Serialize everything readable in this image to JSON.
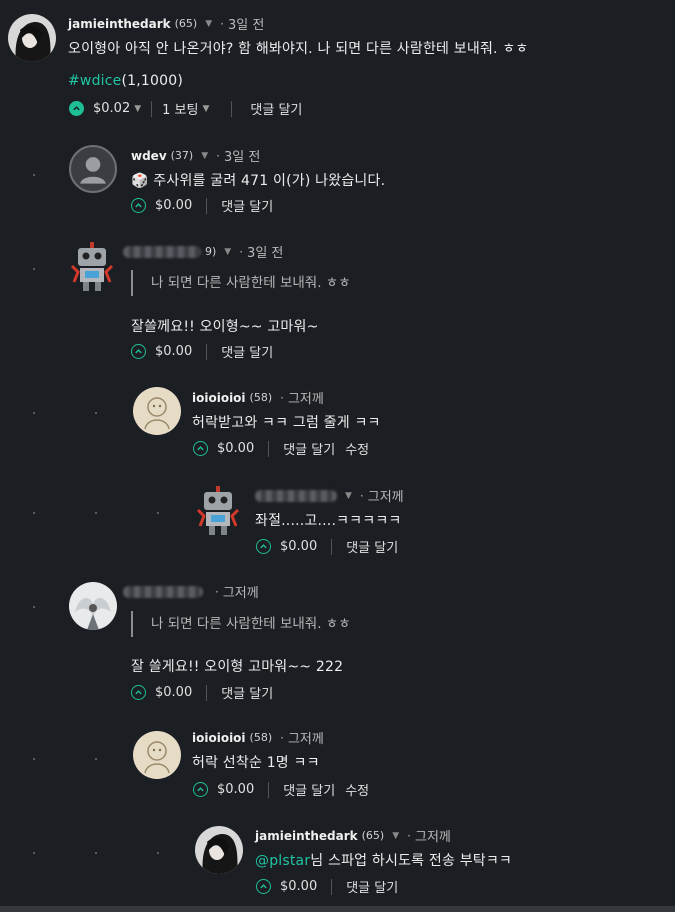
{
  "comments": [
    {
      "author": "jamieinthedark",
      "rep": "(65)",
      "time": "3일 전",
      "body": "오이형아 아직 안 나온거야? 함 해봐야지. 나 되면 다른 사람한테 보내줘. ㅎㅎ",
      "tag": "#wdice",
      "tag_args": "(1,1000)",
      "payout": "$0.02",
      "votes": "1 보팅",
      "reply": "댓글 달기"
    },
    {
      "author": "wdev",
      "rep": "(37)",
      "time": "3일 전",
      "body": "🎲 주사위를 굴려 471 이(가) 나왔습니다.",
      "payout": "$0.00",
      "reply": "댓글 달기"
    },
    {
      "rep": "9)",
      "time": "3일 전",
      "quote": "나 되면 다른 사람한테 보내줘. ㅎㅎ",
      "body": "잘쓸께요!! 오이형~~ 고마워~",
      "payout": "$0.00",
      "reply": "댓글 달기"
    },
    {
      "author": "ioioioioi",
      "rep": "(58)",
      "time": "그저께",
      "body": "허락받고와 ㅋㅋ 그럼 줄게 ㅋㅋ",
      "payout": "$0.00",
      "reply": "댓글 달기",
      "edit": "수정"
    },
    {
      "time": "그저께",
      "body": "좌절.....고....ㅋㅋㅋㅋㅋ",
      "payout": "$0.00",
      "reply": "댓글 달기"
    },
    {
      "time": "그저께",
      "quote": "나 되면 다른 사람한테 보내줘. ㅎㅎ",
      "body": "잘 쓸게요!! 오이형 고마워~~ 222",
      "payout": "$0.00",
      "reply": "댓글 달기"
    },
    {
      "author": "ioioioioi",
      "rep": "(58)",
      "time": "그저께",
      "body": "허락 선착순 1명 ㅋㅋ",
      "payout": "$0.00",
      "reply": "댓글 달기",
      "edit": "수정"
    },
    {
      "author": "jamieinthedark",
      "rep": "(65)",
      "time": "그저께",
      "mention": "@plstar",
      "body": "님 스파업 하시도록 전송 부탁ㅋㅋ",
      "payout": "$0.00",
      "reply": "댓글 달기"
    }
  ],
  "icons": {
    "vote": "upvote-chevron-icon",
    "caret": "caret-down-icon",
    "dice": "dice-icon"
  },
  "colors": {
    "background": "#1b1e23",
    "accent": "#1fbf95",
    "tag": "#20c4a1"
  }
}
